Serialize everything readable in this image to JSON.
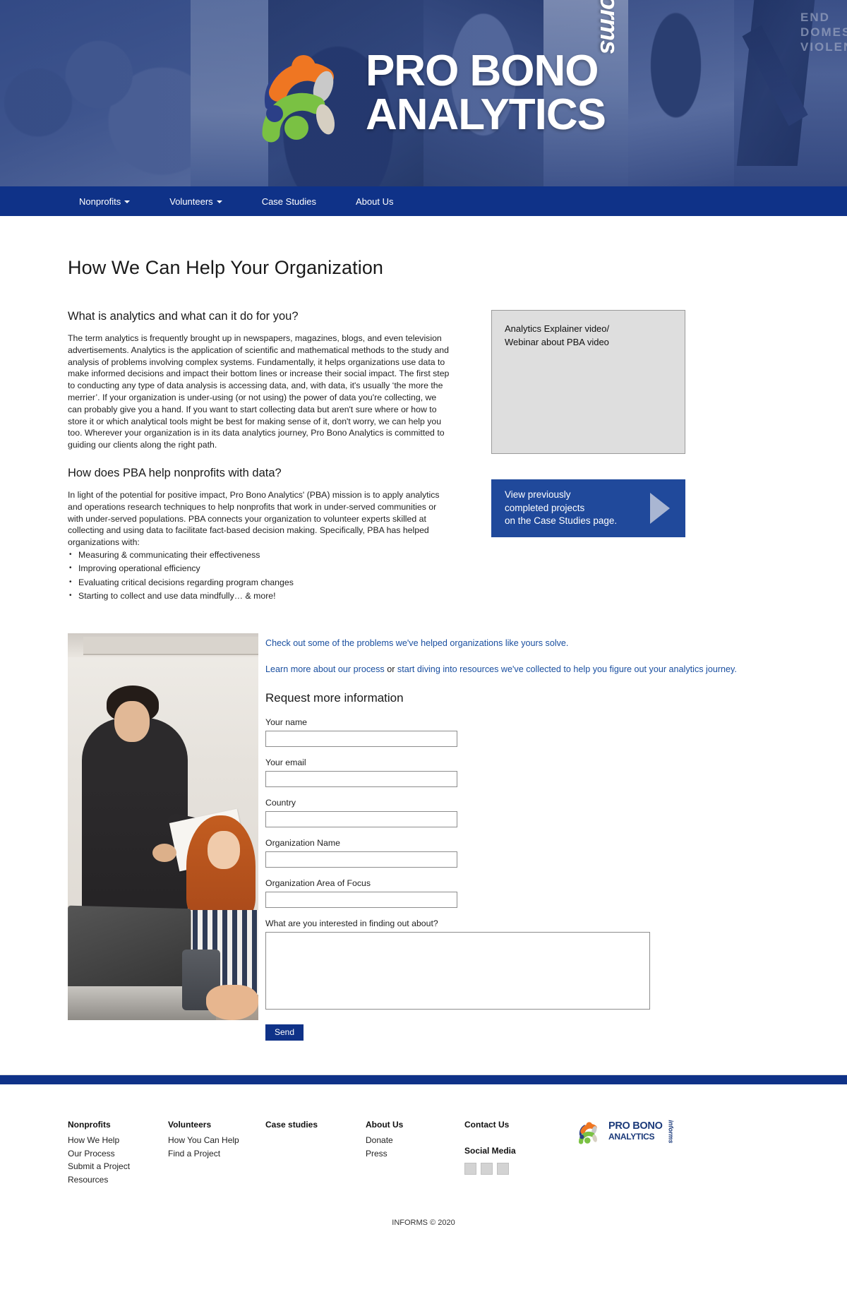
{
  "hero": {
    "brand_line1": "PRO BONO",
    "brand_line2": "ANALYTICS",
    "brand_sub": "informs",
    "poster_text": "END DOMESTIC VIOLENCE"
  },
  "nav": {
    "items": [
      {
        "label": "Nonprofits",
        "has_caret": true
      },
      {
        "label": "Volunteers",
        "has_caret": true
      },
      {
        "label": "Case Studies",
        "has_caret": false
      },
      {
        "label": "About Us",
        "has_caret": false
      }
    ]
  },
  "main": {
    "page_title": "How We Can Help Your Organization",
    "section1": {
      "heading": "What is analytics and what can it do for you?",
      "paragraph": "The term analytics is frequently brought up in newspapers, magazines, blogs, and even television advertisements. Analytics is the application of scientific and mathematical methods to the study and analysis of problems involving complex systems. Fundamentally, it helps organizations use data to make informed decisions and impact their bottom lines or increase their social impact. The first step to conducting any type of data analysis is accessing data, and, with data, it's usually ‘the more the merrier’. If your organization is under-using (or not using) the power of data you're collecting, we can probably give you a hand. If you want to start collecting data but aren't sure where or how to store it or which analytical tools might be best for making sense of it, don't worry, we can help you too. Wherever your organization is in its data analytics journey, Pro Bono Analytics is committed to guiding our clients along the right path."
    },
    "section2": {
      "heading": "How does PBA help nonprofits with data?",
      "paragraph": "In light of the potential for positive impact, Pro Bono Analytics' (PBA) mission is to apply analytics and operations research techniques to help nonprofits that work in under-served communities or with under-served populations. PBA connects your organization to volunteer experts skilled at collecting and using data to facilitate fact-based decision making. Specifically, PBA has helped organizations with:",
      "bullets": [
        "Measuring & communicating their effectiveness",
        "Improving operational efficiency",
        "Evaluating critical decisions regarding program changes",
        "Starting to collect and use data mindfully… & more!"
      ]
    },
    "video_box": {
      "line1": "Analytics Explainer video/",
      "line2": "Webinar about PBA video"
    },
    "cta_box": {
      "line1": "View previously",
      "line2": "completed projects",
      "line3": "on the Case Studies page.",
      "arrow_icon": "play-arrow-icon",
      "color": "#20499b"
    }
  },
  "links": {
    "case_studies_link": "Check out some of the problems we've helped organizations like yours solve.",
    "process_link": "Learn more about our process",
    "between": " or ",
    "resources_link": "start diving into resources we've collected to help you figure out your analytics journey."
  },
  "form": {
    "title": "Request more information",
    "fields": [
      {
        "label": "Your name",
        "value": "",
        "placeholder": "",
        "name": "name-field"
      },
      {
        "label": "Your email",
        "value": "",
        "placeholder": "",
        "name": "email-field"
      },
      {
        "label": "Country",
        "value": "",
        "placeholder": "",
        "name": "country-field"
      },
      {
        "label": "Organization Name",
        "value": "",
        "placeholder": "",
        "name": "organization-name-field"
      },
      {
        "label": "Organization Area of Focus",
        "value": "",
        "placeholder": "",
        "name": "organization-focus-field"
      }
    ],
    "textarea_label": "What are you interested in finding out about?",
    "textarea_value": "",
    "submit_label": "Send"
  },
  "footer": {
    "columns": [
      {
        "head": "Nonprofits",
        "links": [
          "How We Help",
          "Our Process",
          "Submit a Project",
          "Resources"
        ]
      },
      {
        "head": "Volunteers",
        "links": [
          "How You Can Help",
          "Find a Project"
        ]
      },
      {
        "head": "Case studies",
        "links": []
      },
      {
        "head": "About Us",
        "links": [
          "Donate",
          "Press"
        ]
      }
    ],
    "contact_head": "Contact Us",
    "social_head": "Social Media",
    "social_icons": [
      "social-icon-1",
      "social-icon-2",
      "social-icon-3"
    ],
    "logo_line1": "PRO BONO",
    "logo_line2": "ANALYTICS",
    "logo_sub": "informs",
    "copyright": "INFORMS © 2020"
  },
  "colors": {
    "brand_blue": "#0f3288",
    "cta_blue": "#20499b",
    "link_blue": "#1a4fa0",
    "logo_orange": "#ef7622",
    "logo_green": "#7ac143",
    "logo_navy": "#2b3f87",
    "logo_gray": "#c9c9c9"
  }
}
